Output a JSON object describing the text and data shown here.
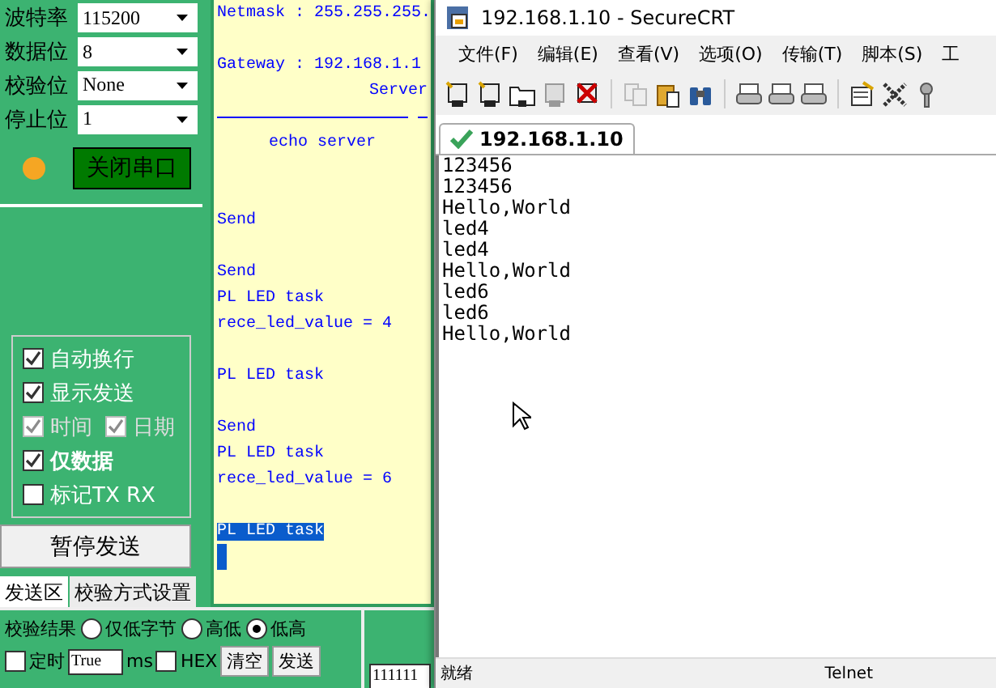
{
  "serial_settings": [
    {
      "label": "波特率",
      "value": "115200"
    },
    {
      "label": "数据位",
      "value": "8"
    },
    {
      "label": "校验位",
      "value": "None"
    },
    {
      "label": "停止位",
      "value": "1"
    }
  ],
  "port_indicator": {
    "on": true
  },
  "port_button": "关闭串口",
  "display_options": [
    [
      {
        "label": "自动换行",
        "checked": true,
        "disabled": false,
        "bold": false
      }
    ],
    [
      {
        "label": "显示发送",
        "checked": true,
        "disabled": false,
        "bold": false
      }
    ],
    [
      {
        "label": "时间",
        "checked": true,
        "disabled": true,
        "bold": false
      },
      {
        "label": "日期",
        "checked": true,
        "disabled": true,
        "bold": false
      }
    ],
    [
      {
        "label": "仅数据",
        "checked": true,
        "disabled": false,
        "bold": true
      }
    ],
    [
      {
        "label": "标记TX RX",
        "checked": false,
        "disabled": false,
        "bold": false
      }
    ]
  ],
  "pause_button": "暂停发送",
  "tabs": [
    {
      "label": "发送区",
      "selected": true
    },
    {
      "label": "校验方式设置",
      "selected": false
    }
  ],
  "checksum": {
    "label": "校验结果",
    "options": [
      {
        "label": "仅低字节",
        "selected": false
      },
      {
        "label": "高低",
        "selected": false
      },
      {
        "label": "低高",
        "selected": true
      }
    ]
  },
  "send_row": {
    "timer": {
      "label": "定时",
      "checked": false
    },
    "interval": "True",
    "unit": "ms",
    "hex": {
      "label": "HEX",
      "checked": false
    },
    "clear_button": "清空",
    "send_button": "发送"
  },
  "send_input": "111111",
  "log": [
    {
      "kind": "line",
      "text": "Netmask : 255.255.255.",
      "selected": false
    },
    {
      "kind": "blank"
    },
    {
      "kind": "line",
      "text": "Gateway : 192.168.1.1",
      "selected": false
    },
    {
      "kind": "right",
      "text": "Server",
      "selected": false
    },
    {
      "kind": "rule"
    },
    {
      "kind": "centered",
      "text": "echo server",
      "selected": false
    },
    {
      "kind": "blank"
    },
    {
      "kind": "blank"
    },
    {
      "kind": "line",
      "text": "Send",
      "selected": false
    },
    {
      "kind": "blank"
    },
    {
      "kind": "line",
      "text": "Send",
      "selected": false
    },
    {
      "kind": "line",
      "text": "PL LED task",
      "selected": false
    },
    {
      "kind": "line",
      "text": "rece_led_value = 4",
      "selected": false
    },
    {
      "kind": "blank"
    },
    {
      "kind": "line",
      "text": "PL LED task",
      "selected": false
    },
    {
      "kind": "blank"
    },
    {
      "kind": "line",
      "text": "Send",
      "selected": false
    },
    {
      "kind": "line",
      "text": "PL LED task",
      "selected": false
    },
    {
      "kind": "line",
      "text": "rece_led_value = 6",
      "selected": false
    },
    {
      "kind": "blank"
    },
    {
      "kind": "line",
      "text": "PL LED task",
      "selected": true
    },
    {
      "kind": "cursor"
    }
  ],
  "securecrt": {
    "title": "192.168.1.10 - SecureCRT",
    "menu": [
      "文件(F)",
      "编辑(E)",
      "查看(V)",
      "选项(O)",
      "传输(T)",
      "脚本(S)",
      "工"
    ],
    "tab": {
      "label": "192.168.1.10",
      "connected": true
    },
    "terminal_lines": [
      "123456",
      "123456",
      "Hello,World",
      "led4",
      "led4",
      "Hello,World",
      "led6",
      "led6",
      "Hello,World"
    ],
    "status": {
      "state": "就绪",
      "protocol": "Telnet"
    }
  }
}
